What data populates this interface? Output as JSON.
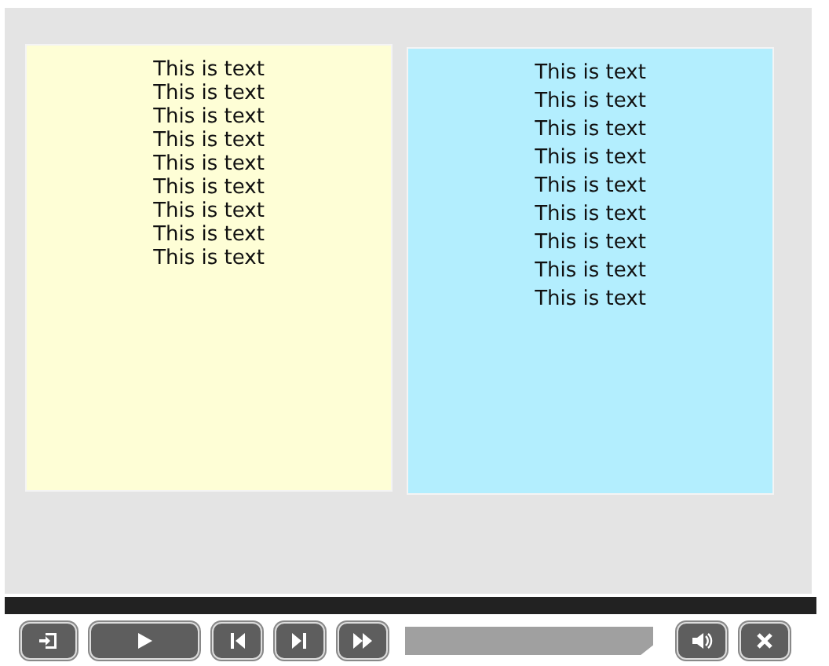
{
  "panels": [
    {
      "color": "#fefed6",
      "kind": "compact",
      "lines": [
        "This is text",
        "This is text",
        "This is text",
        "This is text",
        "This is text",
        "This is text",
        "This is text",
        "This is text",
        "This is text"
      ]
    },
    {
      "color": "#b3eefe",
      "kind": "spaced",
      "lines": [
        "This is text",
        "This is text",
        "This is text",
        "This is text",
        "This is text",
        "This is text",
        "This is text",
        "This is text",
        "This is text"
      ]
    }
  ]
}
